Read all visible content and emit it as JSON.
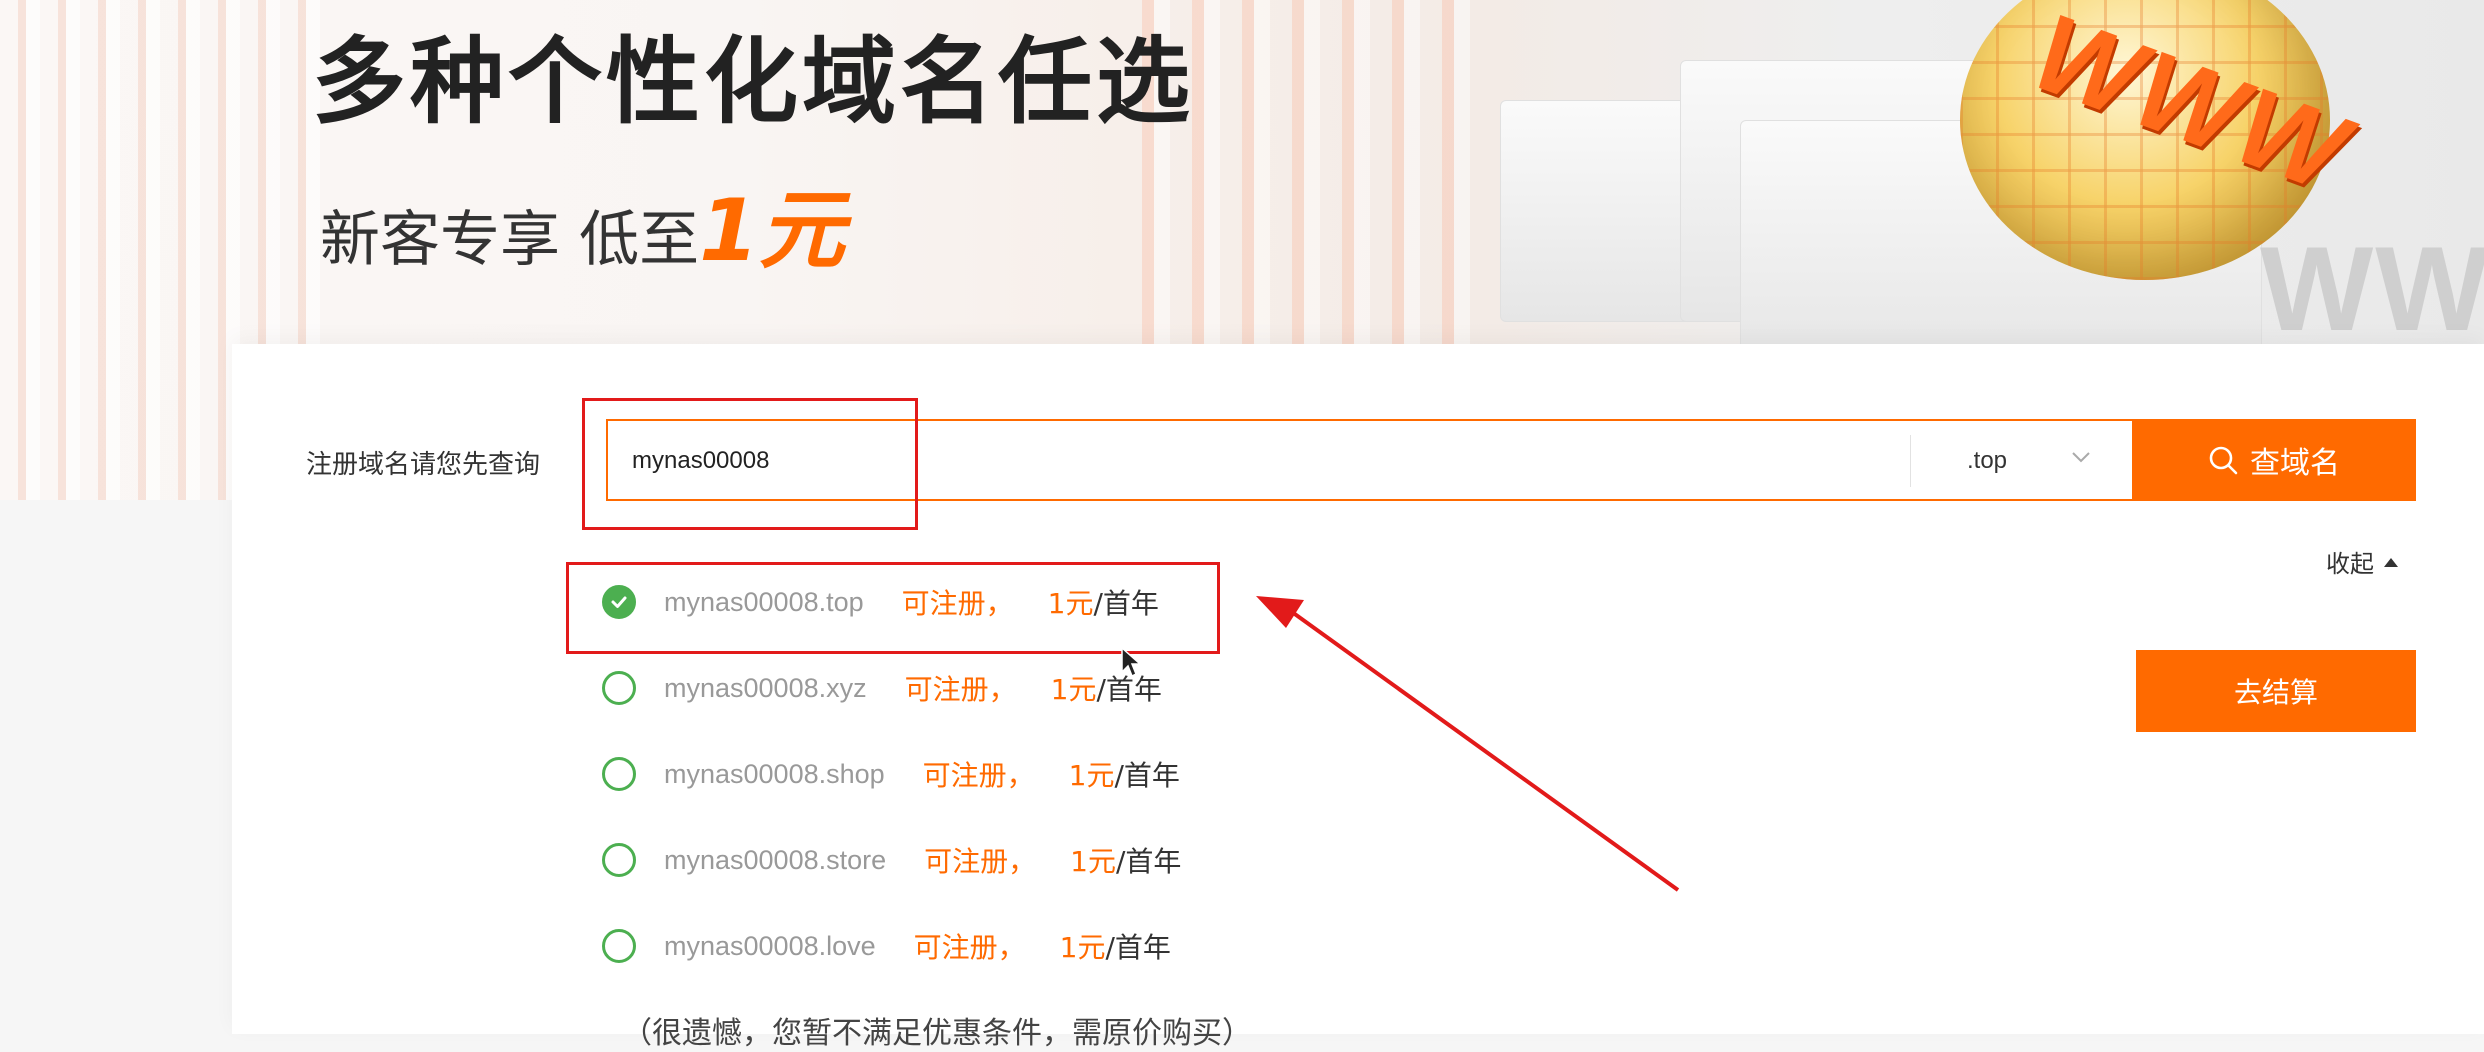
{
  "banner": {
    "title": "多种个性化域名任选",
    "subtitle_prefix": "新客专享 低至",
    "subtitle_price": "1元",
    "globe_text": "WWW",
    "globe_shadow_text": "WW"
  },
  "search": {
    "label": "注册域名请您先查询",
    "input_value": "mynas00008",
    "suffix": ".top",
    "button_label": "查域名"
  },
  "collapse_label": "收起",
  "checkout_label": "去结算",
  "results": [
    {
      "domain": "mynas00008.top",
      "status": "可注册，",
      "price": "1元",
      "unit": "/首年",
      "selected": true
    },
    {
      "domain": "mynas00008.xyz",
      "status": "可注册，",
      "price": "1元",
      "unit": "/首年",
      "selected": false
    },
    {
      "domain": "mynas00008.shop",
      "status": "可注册，",
      "price": "1元",
      "unit": "/首年",
      "selected": false
    },
    {
      "domain": "mynas00008.store",
      "status": "可注册，",
      "price": "1元",
      "unit": "/首年",
      "selected": false
    },
    {
      "domain": "mynas00008.love",
      "status": "可注册，",
      "price": "1元",
      "unit": "/首年",
      "selected": false
    }
  ],
  "notice": "（很遗憾，您暂不满足优惠条件，需原价购买）",
  "colors": {
    "accent": "#ff6a00",
    "success": "#4caf50",
    "annotation": "#e21a1a"
  }
}
